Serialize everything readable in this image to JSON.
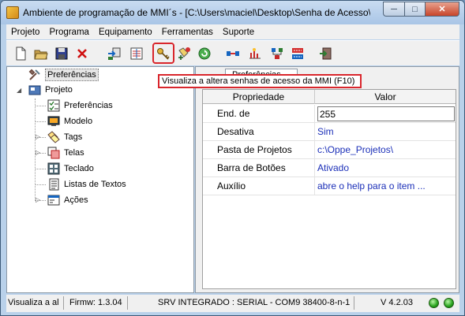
{
  "window": {
    "title": "Ambiente de programação de MMI´s - [C:\\Users\\maciel\\Desktop\\Senha de Acesso\\...",
    "buttons": {
      "minimize": "─",
      "maximize": "□",
      "close": "✕"
    }
  },
  "menu": [
    "Projeto",
    "Programa",
    "Equipamento",
    "Ferramentas",
    "Suporte"
  ],
  "toolbar": {
    "buttons": [
      "new-file-icon",
      "open-folder-icon",
      "save-icon",
      "delete-icon",
      "transfer-icon",
      "compile-icon",
      "password-key-icon",
      "add-tag-icon",
      "refresh-icon",
      "connect-icon",
      "communication-icon",
      "network-icon",
      "network-config-icon",
      "exit-icon"
    ],
    "highlighted": "password-key-icon"
  },
  "tooltip": "Visualiza a altera senhas de acesso da MMI (F10)",
  "tree": {
    "root_prefs": "Preferências",
    "project": "Projeto",
    "items": [
      {
        "label": "Preferências",
        "icon": "checklist-icon",
        "expandable": false
      },
      {
        "label": "Modelo",
        "icon": "monitor-icon",
        "expandable": false
      },
      {
        "label": "Tags",
        "icon": "tags-icon",
        "expandable": true
      },
      {
        "label": "Telas",
        "icon": "screens-icon",
        "expandable": true
      },
      {
        "label": "Teclado",
        "icon": "keyboard-icon",
        "expandable": false
      },
      {
        "label": "Listas de Textos",
        "icon": "text-list-icon",
        "expandable": false
      },
      {
        "label": "Ações",
        "icon": "actions-icon",
        "expandable": true
      }
    ]
  },
  "panel": {
    "tab_label": "Preferências",
    "columns": [
      "Propriedade",
      "Valor"
    ],
    "rows": [
      {
        "prop": "End. de",
        "value": "255"
      },
      {
        "prop": "Desativa",
        "value": "Sim"
      },
      {
        "prop": "Pasta de Projetos",
        "value": "c:\\Oppe_Projetos\\"
      },
      {
        "prop": "Barra de Botões",
        "value": "Ativado"
      },
      {
        "prop": "Auxílio",
        "value": "abre o help para o item ..."
      }
    ]
  },
  "status": {
    "hint": "Visualiza a al",
    "firmware": "Firmw: 1.3.04",
    "connection": "SRV INTEGRADO : SERIAL - COM9 38400-8-n-1",
    "version": "V 4.2.03",
    "led_color": "#27a21c"
  }
}
